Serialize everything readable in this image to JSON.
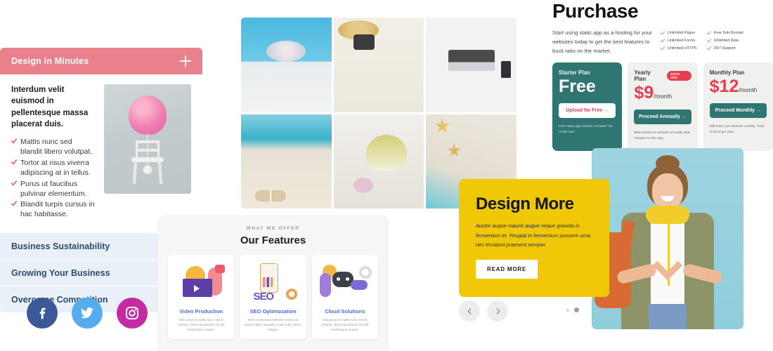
{
  "accordion": {
    "header": {
      "title": "Design in Minutes",
      "expand_icon": "plus-icon"
    },
    "panel": {
      "lead": "Interdum velit euismod in pellentesque massa placerat duis.",
      "bullets": [
        "Mattis nunc sed blandit libero volutpat.",
        "Tortor at risus viverra adipiscing at in tellus.",
        "Purus ut faucibus pulvinar elementum.",
        "Blandit turpis cursus in hac habitasse."
      ],
      "image_alt": "pink balloon floating above a white chair"
    },
    "items": [
      {
        "label": "Business Sustainability"
      },
      {
        "label": "Growing Your Business"
      },
      {
        "label": "Overcome Competition"
      }
    ]
  },
  "socials": [
    {
      "name": "facebook",
      "glyph": "f",
      "color": "#3b5998"
    },
    {
      "name": "twitter",
      "glyph": "twitter-bird",
      "color": "#55acee"
    },
    {
      "name": "instagram",
      "glyph": "camera",
      "color": "#c32aa3"
    }
  ],
  "photo_grid": {
    "photos": [
      {
        "alt": "woman in sun hat in swimming pool"
      },
      {
        "alt": "straw hat, camera and jeans flat lay"
      },
      {
        "alt": "hands typing on laptop from above"
      },
      {
        "alt": "flip flops on a sandy beach"
      },
      {
        "alt": "seashells on white sand"
      },
      {
        "alt": "starfish on sand beside turquoise water"
      }
    ]
  },
  "features": {
    "kicker": "WHAT WE OFFER",
    "title": "Our Features",
    "cards": [
      {
        "name": "Video Production",
        "desc": "Nisl purus in mollis nunc sed id semper. Rhoncus aenean vel elit scelerisque mauris.",
        "art": "video-production-illustration"
      },
      {
        "name": "SEO Optimozation",
        "desc": "Nunc consequat interdum varius sit amet mattis vulputate enim nulla. Risus feugiat.",
        "art": "seo-illustration"
      },
      {
        "name": "Cloud Solutions",
        "desc": "Nisl purus in mollis nunc sed id semper. Rhoncus aenean vel elit scelerisque mauris.",
        "art": "cloud-robot-illustration"
      }
    ]
  },
  "purchase": {
    "title": "Purchase",
    "description": "Start using static.app as a hosting for your websites today to get the best features to buck ratio on the market.",
    "feature_columns": [
      [
        "Unlimited Pages",
        "Unlimited Forms",
        "Unlimited HTTPS"
      ],
      [
        "Free Sub-Domain",
        "Unlimited Data",
        "24/7 Support"
      ]
    ],
    "plans": [
      {
        "name": "Starter Plan",
        "badge": "",
        "price": "Free",
        "per": "",
        "cta": "Upload for Free  →",
        "fine": "Free static.app domain included. No credit card"
      },
      {
        "name": "Yearly Plan",
        "badge": "SAVE 25%",
        "price": "$9",
        "per": "/month",
        "cta": "Proceed Annually →",
        "fine": "Billed $108 per website annually. $36 cheaper to this way."
      },
      {
        "name": "Monthly Plan",
        "badge": "",
        "price": "$12",
        "per": "/month",
        "cta": "Proceed Monthly →",
        "fine": "Billed $12 per website monthly. Total is $144 per year."
      }
    ]
  },
  "design_more": {
    "title": "Design More",
    "text": "Auctor augue mauris augue neque gravida in fermentum et. Feugiat in fermentum posuere urna nec tincidunt praesent semper.",
    "button": "READ MORE"
  },
  "carousel": {
    "prev_icon": "chevron-left-icon",
    "next_icon": "chevron-right-icon",
    "dots": 2,
    "active_dot": 2
  },
  "portrait": {
    "alt": "smiling young woman with backpack and yellow headphones making a heart with her hands"
  },
  "colors": {
    "pink": "#e8818b",
    "teal": "#2f7571",
    "red": "#e4404f",
    "yellow": "#f0c808",
    "accordion_blue": "#e9f0f8",
    "accordion_text": "#2d4a6b",
    "feature_link": "#4a6fd4"
  }
}
